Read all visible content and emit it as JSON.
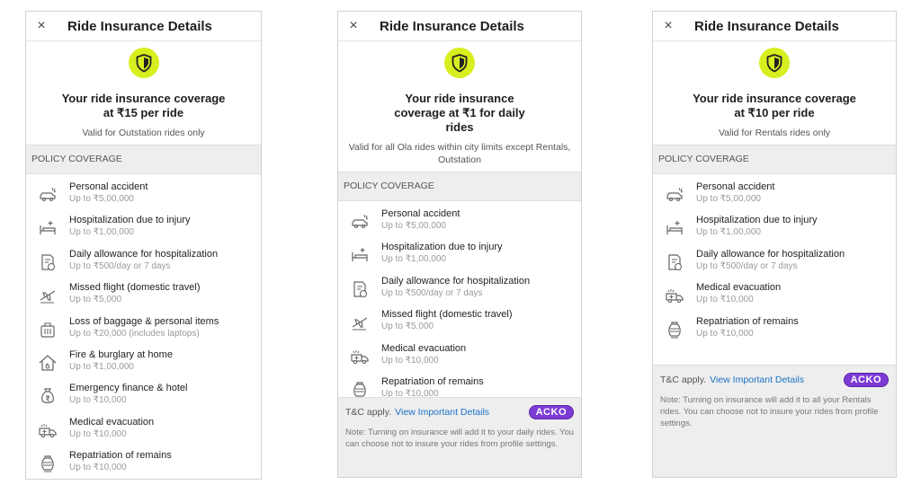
{
  "screens": [
    {
      "close_icon": "×",
      "title": "Ride Insurance Details",
      "headline": "Your ride insurance coverage at ₹15 per ride",
      "validity": "Valid for Outstation rides only",
      "section": "POLICY COVERAGE",
      "items": [
        {
          "icon": "car-crash-icon",
          "name": "Personal accident",
          "amount": "Up to ₹5,00,000"
        },
        {
          "icon": "hospital-bed-icon",
          "name": "Hospitalization due to injury",
          "amount": "Up to ₹1,00,000"
        },
        {
          "icon": "document-rupee-icon",
          "name": "Daily allowance for hospitalization",
          "amount": "Up to ₹500/day or 7 days"
        },
        {
          "icon": "plane-icon",
          "name": "Missed flight (domestic travel)",
          "amount": "Up to ₹5,000"
        },
        {
          "icon": "luggage-icon",
          "name": "Loss of baggage & personal items",
          "amount": "Up to ₹20,000 (includes laptops)"
        },
        {
          "icon": "house-fire-icon",
          "name": "Fire & burglary at home",
          "amount": "Up to ₹1,00,000"
        },
        {
          "icon": "money-bag-icon",
          "name": "Emergency finance & hotel",
          "amount": "Up to ₹10,000"
        },
        {
          "icon": "ambulance-icon",
          "name": "Medical evacuation",
          "amount": "Up to ₹10,000"
        },
        {
          "icon": "urn-icon",
          "name": "Repatriation of remains",
          "amount": "Up to ₹10,000"
        }
      ]
    },
    {
      "close_icon": "×",
      "title": "Ride Insurance Details",
      "headline": "Your ride insurance coverage at ₹1 for daily rides",
      "validity": "Valid for all Ola rides within city limits except Rentals, Outstation",
      "section": "POLICY COVERAGE",
      "items": [
        {
          "icon": "car-crash-icon",
          "name": "Personal accident",
          "amount": "Up to ₹5,00,000"
        },
        {
          "icon": "hospital-bed-icon",
          "name": "Hospitalization due to injury",
          "amount": "Up to ₹1,00,000"
        },
        {
          "icon": "document-rupee-icon",
          "name": "Daily allowance for hospitalization",
          "amount": "Up to ₹500/day or 7 days"
        },
        {
          "icon": "plane-icon",
          "name": "Missed flight (domestic travel)",
          "amount": "Up to ₹5,000"
        },
        {
          "icon": "ambulance-icon",
          "name": "Medical evacuation",
          "amount": "Up to ₹10,000"
        },
        {
          "icon": "urn-icon",
          "name": "Repatriation of remains",
          "amount": "Up to ₹10,000"
        }
      ],
      "tc_label": "T&C apply.",
      "tc_link": "View Important Details",
      "brand": "ACKO",
      "note": "Note: Turning on insurance will add it to your daily rides. You can choose not to insure your rides from profile settings."
    },
    {
      "close_icon": "×",
      "title": "Ride Insurance Details",
      "headline": "Your ride insurance coverage at ₹10 per ride",
      "validity": "Valid for Rentals rides only",
      "section": "POLICY COVERAGE",
      "items": [
        {
          "icon": "car-crash-icon",
          "name": "Personal accident",
          "amount": "Up to ₹5,00,000"
        },
        {
          "icon": "hospital-bed-icon",
          "name": "Hospitalization due to injury",
          "amount": "Up to ₹1,00,000"
        },
        {
          "icon": "document-rupee-icon",
          "name": "Daily allowance for hospitalization",
          "amount": "Up to ₹500/day or 7 days"
        },
        {
          "icon": "ambulance-icon",
          "name": "Medical evacuation",
          "amount": "Up to ₹10,000"
        },
        {
          "icon": "urn-icon",
          "name": "Repatriation of remains",
          "amount": "Up to ₹10,000"
        }
      ],
      "tc_label": "T&C apply.",
      "tc_link": "View Important Details",
      "brand": "ACKO",
      "note": "Note: Turning on insurance will add it to all your Rentals rides. You can choose not to insure your rides from profile settings."
    }
  ],
  "colors": {
    "accent": "#d7ef1e",
    "link": "#1a73c8",
    "brand": "#7d3bd6"
  }
}
